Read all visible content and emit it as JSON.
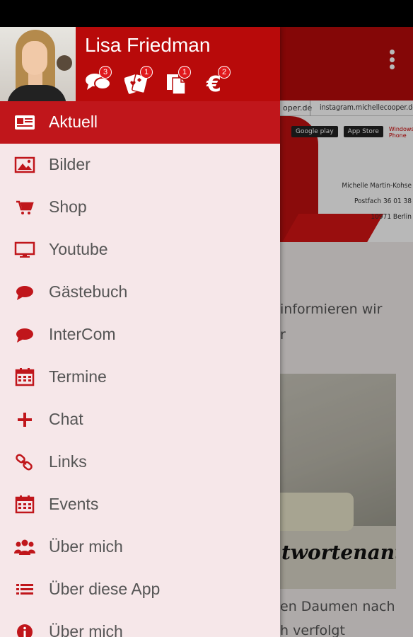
{
  "user": {
    "name": "Lisa Friedman",
    "stats": [
      {
        "icon": "chat-icon",
        "count": "3"
      },
      {
        "icon": "cards-icon",
        "count": "1"
      },
      {
        "icon": "documents-icon",
        "count": "1"
      },
      {
        "icon": "euro-icon",
        "count": "2"
      }
    ]
  },
  "menu": [
    {
      "label": "Aktuell",
      "icon": "newspaper-icon",
      "active": true
    },
    {
      "label": "Bilder",
      "icon": "image-icon"
    },
    {
      "label": "Shop",
      "icon": "cart-icon"
    },
    {
      "label": "Youtube",
      "icon": "monitor-icon"
    },
    {
      "label": "Gästebuch",
      "icon": "speech-bubble-icon"
    },
    {
      "label": "InterCom",
      "icon": "speech-bubble-icon"
    },
    {
      "label": "Termine",
      "icon": "calendar-icon"
    },
    {
      "label": "Chat",
      "icon": "plus-icon"
    },
    {
      "label": "Links",
      "icon": "link-icon"
    },
    {
      "label": "Events",
      "icon": "calendar-icon"
    },
    {
      "label": "Über mich",
      "icon": "group-icon"
    },
    {
      "label": "Über diese App",
      "icon": "list-icon"
    },
    {
      "label": "Über mich",
      "icon": "info-icon"
    }
  ],
  "background": {
    "url_1": "oper.de",
    "url_2": "instagram.michellecooper.de",
    "store_badges": [
      "Google play",
      "App Store",
      "Windows Phone"
    ],
    "address": [
      "Michelle Martin-Kohse",
      "Postfach 36 01 38",
      "10971 Berlin"
    ],
    "text_line_1": "informieren wir",
    "text_line_2": "r",
    "photo_caption": "twortenantworten",
    "text_line_3": "en Daumen nach",
    "text_line_4": "h verfolgt"
  },
  "colors": {
    "accent": "#b80a0a",
    "active_item": "#c0161b",
    "drawer_bg": "#f6e7e9",
    "icon_red": "#c0161b",
    "badge_red": "#e0181c"
  }
}
